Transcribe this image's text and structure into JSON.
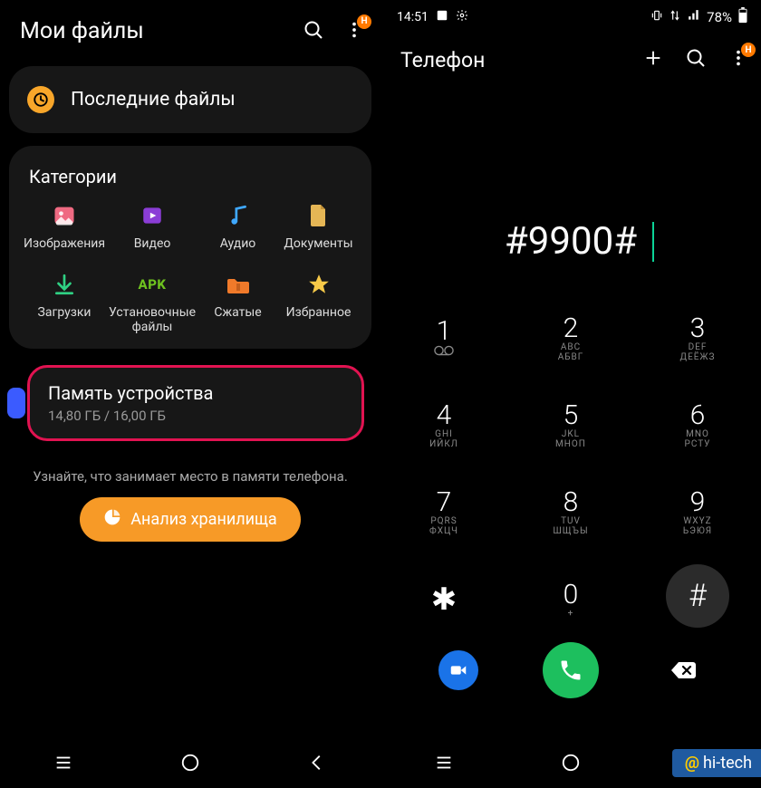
{
  "left": {
    "title": "Мои файлы",
    "badge_letter": "Н",
    "recent_label": "Последние файлы",
    "categories_title": "Категории",
    "categories": [
      {
        "name": "images",
        "label": "Изображения"
      },
      {
        "name": "video",
        "label": "Видео"
      },
      {
        "name": "audio",
        "label": "Аудио"
      },
      {
        "name": "docs",
        "label": "Документы"
      },
      {
        "name": "downloads",
        "label": "Загрузки"
      },
      {
        "name": "apk",
        "label": "Установочные файлы",
        "text_icon": "APK"
      },
      {
        "name": "archives",
        "label": "Сжатые"
      },
      {
        "name": "fav",
        "label": "Избранное"
      }
    ],
    "storage_title": "Память устройства",
    "storage_sub": "14,80 ГБ / 16,00 ГБ",
    "hint": "Узнайте, что занимает место в памяти телефона.",
    "analyze_label": "Анализ хранилища"
  },
  "right": {
    "status_time": "14:51",
    "battery_text": "78%",
    "title": "Телефон",
    "badge_letter": "Н",
    "dialed": "#9900#",
    "keys": [
      {
        "num": "1",
        "sub": "",
        "vm": true
      },
      {
        "num": "2",
        "sub": "ABC\nАБВГ"
      },
      {
        "num": "3",
        "sub": "DEF\nДЕЁЖЗ"
      },
      {
        "num": "4",
        "sub": "GHI\nИЙКЛ"
      },
      {
        "num": "5",
        "sub": "JKL\nМНОП"
      },
      {
        "num": "6",
        "sub": "MNO\nРСТУ"
      },
      {
        "num": "7",
        "sub": "PQRS\nФХЦЧ"
      },
      {
        "num": "8",
        "sub": "TUV\nШЩЪЫ"
      },
      {
        "num": "9",
        "sub": "WXYZ\nЬЭЮЯ"
      },
      {
        "num": "✱",
        "sub": "",
        "cls": "key-star"
      },
      {
        "num": "0",
        "sub": "+"
      },
      {
        "num": "#",
        "sub": "",
        "cls": "key-hash"
      }
    ]
  },
  "watermark": {
    "at": "@",
    "text": "hi-tech"
  }
}
